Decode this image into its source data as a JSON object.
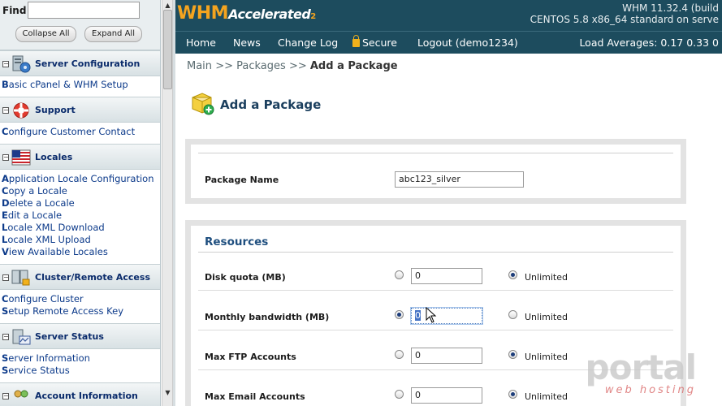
{
  "sidebar": {
    "find_label": "Find",
    "find_value": "",
    "collapse_all": "Collapse All",
    "expand_all": "Expand All",
    "sections": [
      {
        "title": "Server Configuration",
        "items": [
          "Basic cPanel & WHM Setup"
        ]
      },
      {
        "title": "Support",
        "items": [
          "Configure Customer Contact"
        ]
      },
      {
        "title": "Locales",
        "items": [
          "Application Locale Configuration",
          "Copy a Locale",
          "Delete a Locale",
          "Edit a Locale",
          "Locale XML Download",
          "Locale XML Upload",
          "View Available Locales"
        ]
      },
      {
        "title": "Cluster/Remote Access",
        "items": [
          "Configure Cluster",
          "Setup Remote Access Key"
        ]
      },
      {
        "title": "Server Status",
        "items": [
          "Server Information",
          "Service Status"
        ]
      },
      {
        "title": "Account Information",
        "items": []
      }
    ]
  },
  "header": {
    "logo_main": "WHM",
    "logo_accent": "Accelerated",
    "logo_suffix": "2",
    "version": "WHM 11.32.4 (build",
    "os": "CENTOS 5.8 x86_64 standard on serve",
    "nav": [
      "Home",
      "News",
      "Change Log",
      "Secure",
      "Logout (demo1234)"
    ],
    "load_averages": "Load Averages: 0.17 0.33 0"
  },
  "breadcrumb": {
    "main": "Main",
    "sep1": ">>",
    "packages": "Packages",
    "sep2": ">>",
    "current": "Add a Package"
  },
  "page_title": "Add a Package",
  "package": {
    "name_label": "Package Name",
    "name_value": "abc123_silver"
  },
  "resources": {
    "title": "Resources",
    "unlimited_label": "Unlimited",
    "rows": [
      {
        "label": "Disk quota (MB)",
        "value": "0",
        "selected": "unlimited"
      },
      {
        "label": "Monthly bandwidth (MB)",
        "value": "0",
        "selected": "value"
      },
      {
        "label": "Max FTP Accounts",
        "value": "0",
        "selected": "unlimited"
      },
      {
        "label": "Max Email Accounts",
        "value": "0",
        "selected": "unlimited"
      }
    ]
  },
  "watermark": {
    "brand": "portal",
    "tag": "web hosting"
  },
  "colors": {
    "header_bg": "#1d4c5e",
    "logo_orange": "#f4a41f",
    "link_blue": "#0c3a8a",
    "title_blue": "#1f4f7f"
  }
}
